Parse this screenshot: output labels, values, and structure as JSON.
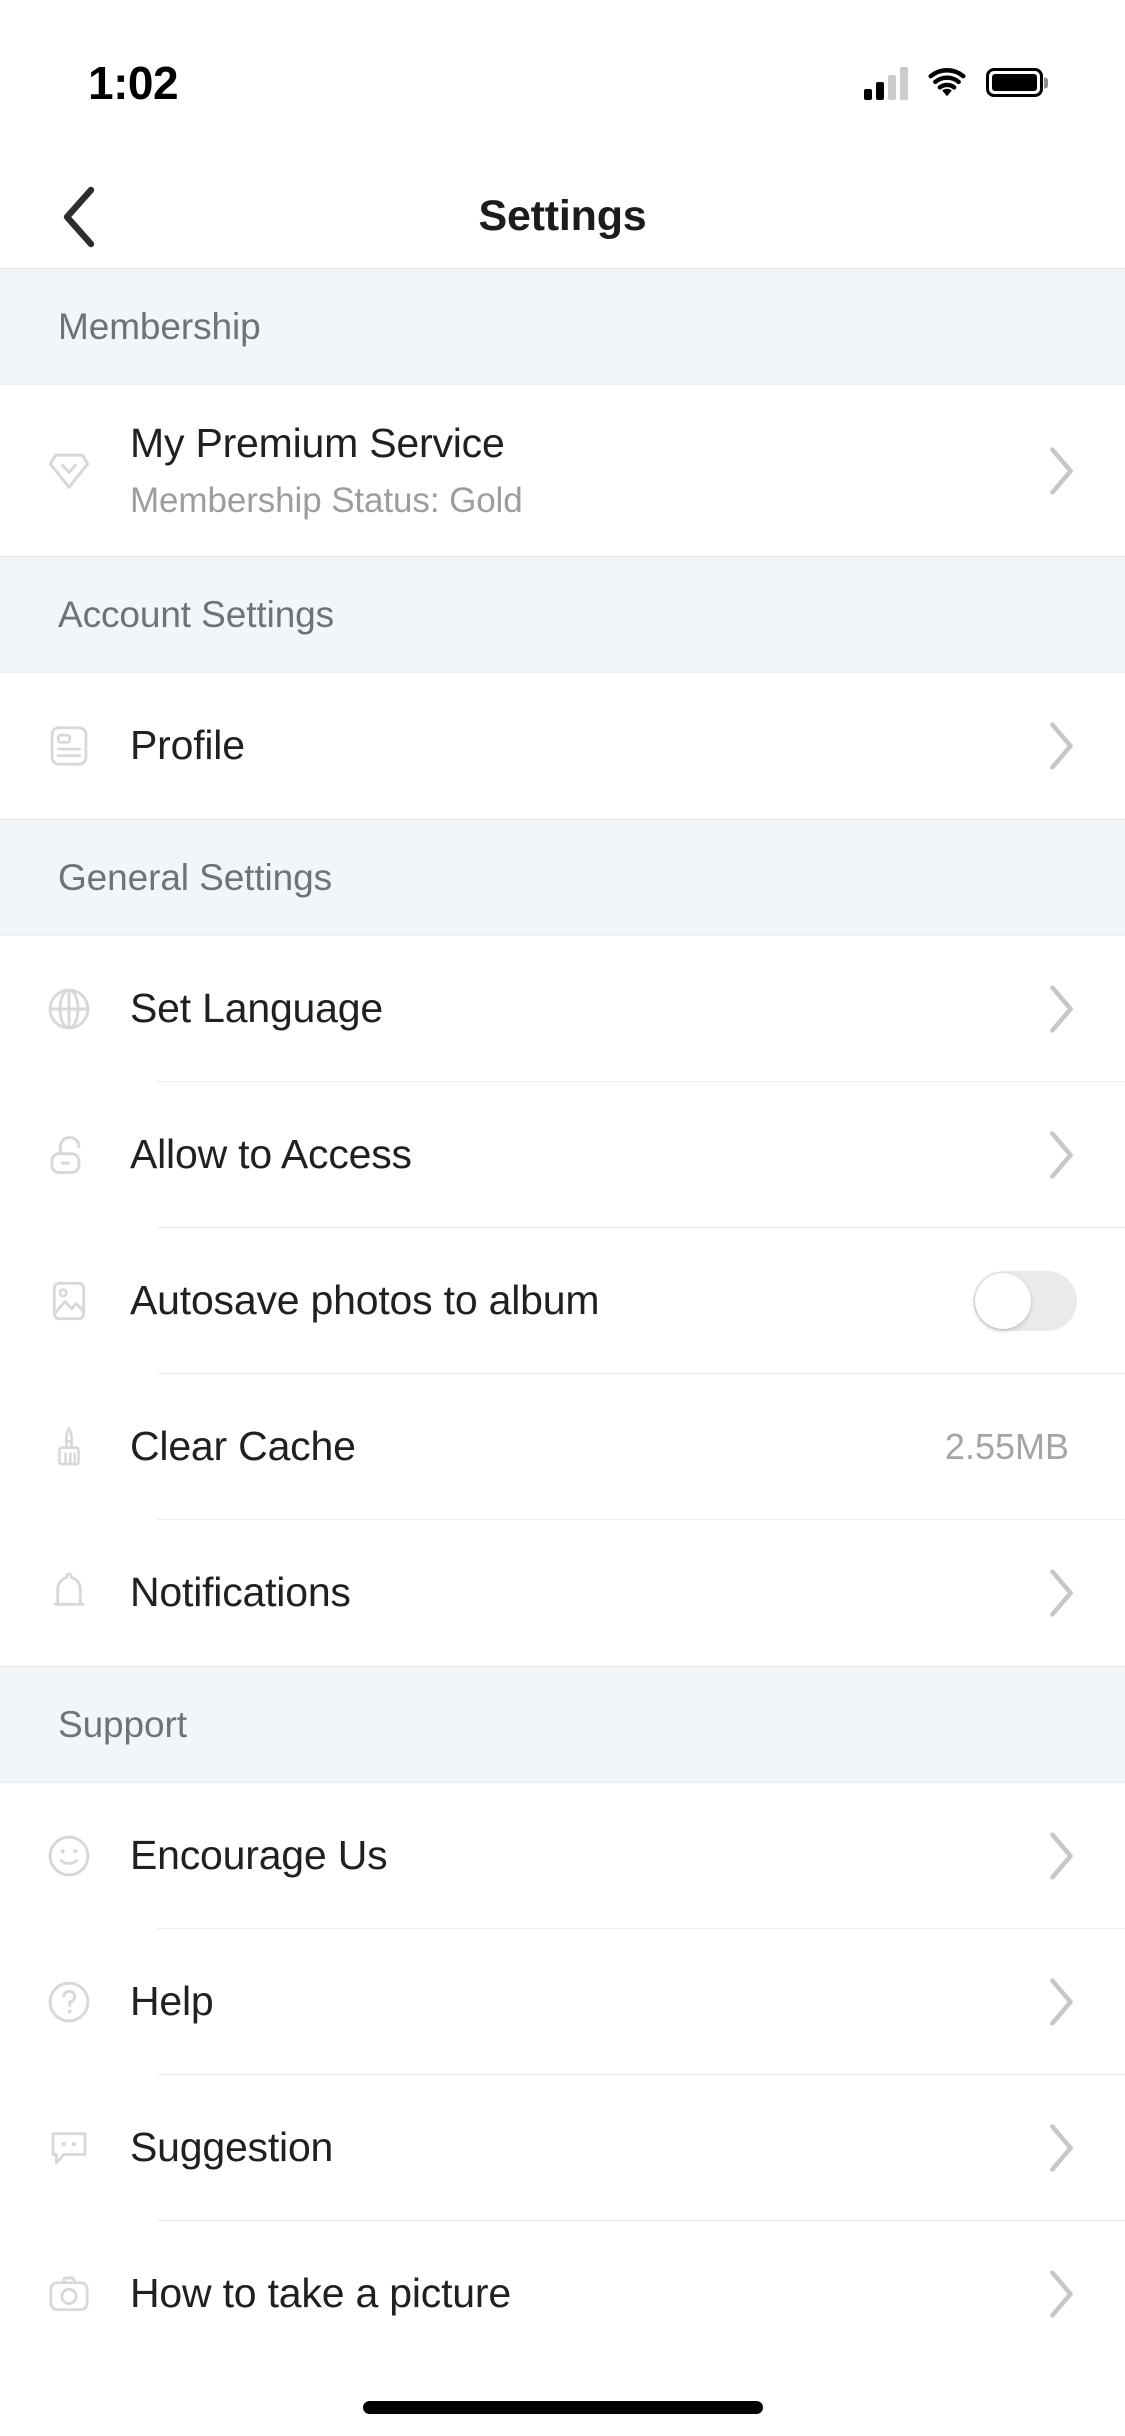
{
  "status_bar": {
    "time": "1:02",
    "signal_icon": "cellular-signal-icon",
    "wifi_icon": "wifi-icon",
    "battery_icon": "battery-icon"
  },
  "nav": {
    "back_icon": "back-chevron-icon",
    "title": "Settings"
  },
  "colors": {
    "section_header_bg": "#f2f6f9",
    "section_header_text": "#6f7277",
    "row_title": "#1f2023",
    "row_sub": "#9b9da1",
    "icon": "#d4d6d8",
    "chevron": "#c5c7ca",
    "divider": "#ececee",
    "toggle_off_track": "#e9eaec"
  },
  "sections": [
    {
      "header": "Membership",
      "rows": [
        {
          "icon": "diamond-gem-icon",
          "title": "My Premium Service",
          "subtitle": "Membership Status: Gold",
          "accessory": "chevron"
        }
      ]
    },
    {
      "header": "Account Settings",
      "rows": [
        {
          "icon": "id-card-icon",
          "title": "Profile",
          "accessory": "chevron"
        }
      ]
    },
    {
      "header": "General Settings",
      "rows": [
        {
          "icon": "globe-icon",
          "title": "Set Language",
          "accessory": "chevron"
        },
        {
          "icon": "unlock-padlock-icon",
          "title": "Allow to Access",
          "accessory": "chevron"
        },
        {
          "icon": "photo-image-icon",
          "title": "Autosave photos to album",
          "accessory": "toggle",
          "toggle_on": false
        },
        {
          "icon": "broom-brush-icon",
          "title": "Clear Cache",
          "accessory": "value",
          "value": "2.55MB"
        },
        {
          "icon": "bell-icon",
          "title": "Notifications",
          "accessory": "chevron"
        }
      ]
    },
    {
      "header": "Support",
      "rows": [
        {
          "icon": "smiley-face-icon",
          "title": "Encourage Us",
          "accessory": "chevron"
        },
        {
          "icon": "question-circle-icon",
          "title": "Help",
          "accessory": "chevron"
        },
        {
          "icon": "speech-bubble-icon",
          "title": "Suggestion",
          "accessory": "chevron"
        },
        {
          "icon": "camera-icon",
          "title": "How to take a picture",
          "accessory": "chevron"
        }
      ]
    }
  ]
}
